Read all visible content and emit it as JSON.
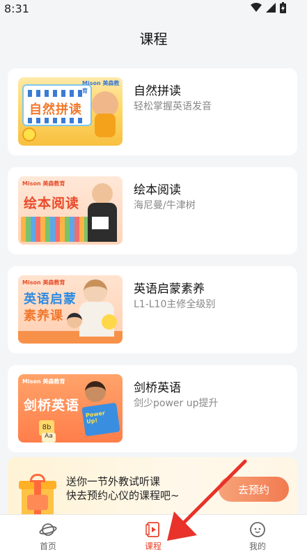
{
  "status_bar": {
    "time": "8:31"
  },
  "header": {
    "title": "课程"
  },
  "courses": [
    {
      "title": "自然拼读",
      "subtitle": "轻松掌握英语发音",
      "thumb_text": "自然拼读",
      "thumb_brand": "Mison 美森教育"
    },
    {
      "title": "绘本阅读",
      "subtitle": "海尼曼/牛津树",
      "thumb_text": "绘本阅读",
      "thumb_brand": "Mison 美森教育"
    },
    {
      "title": "英语启蒙素养",
      "subtitle": "L1-L10主修全级别",
      "thumb_text_1": "英语启蒙",
      "thumb_text_2": "素养课",
      "thumb_brand": "Mison 美森教育"
    },
    {
      "title": "剑桥英语",
      "subtitle": "剑少power up提升",
      "thumb_text": "剑桥英语",
      "thumb_brand": "Mison 美森教育",
      "thumb_book": "Power Up!"
    }
  ],
  "promo": {
    "line1": "送你一节外教试听课",
    "line2": "快去预约心仪的课程吧~",
    "button": "去预约"
  },
  "tabbar": {
    "tabs": [
      {
        "label": "首页",
        "icon": "planet-icon"
      },
      {
        "label": "课程",
        "icon": "play-book-icon",
        "active": true
      },
      {
        "label": "我的",
        "icon": "face-icon"
      }
    ]
  },
  "colors": {
    "accent": "#e8442a",
    "promo_button": "#f27a50",
    "annotation_arrow": "#e8322a"
  }
}
